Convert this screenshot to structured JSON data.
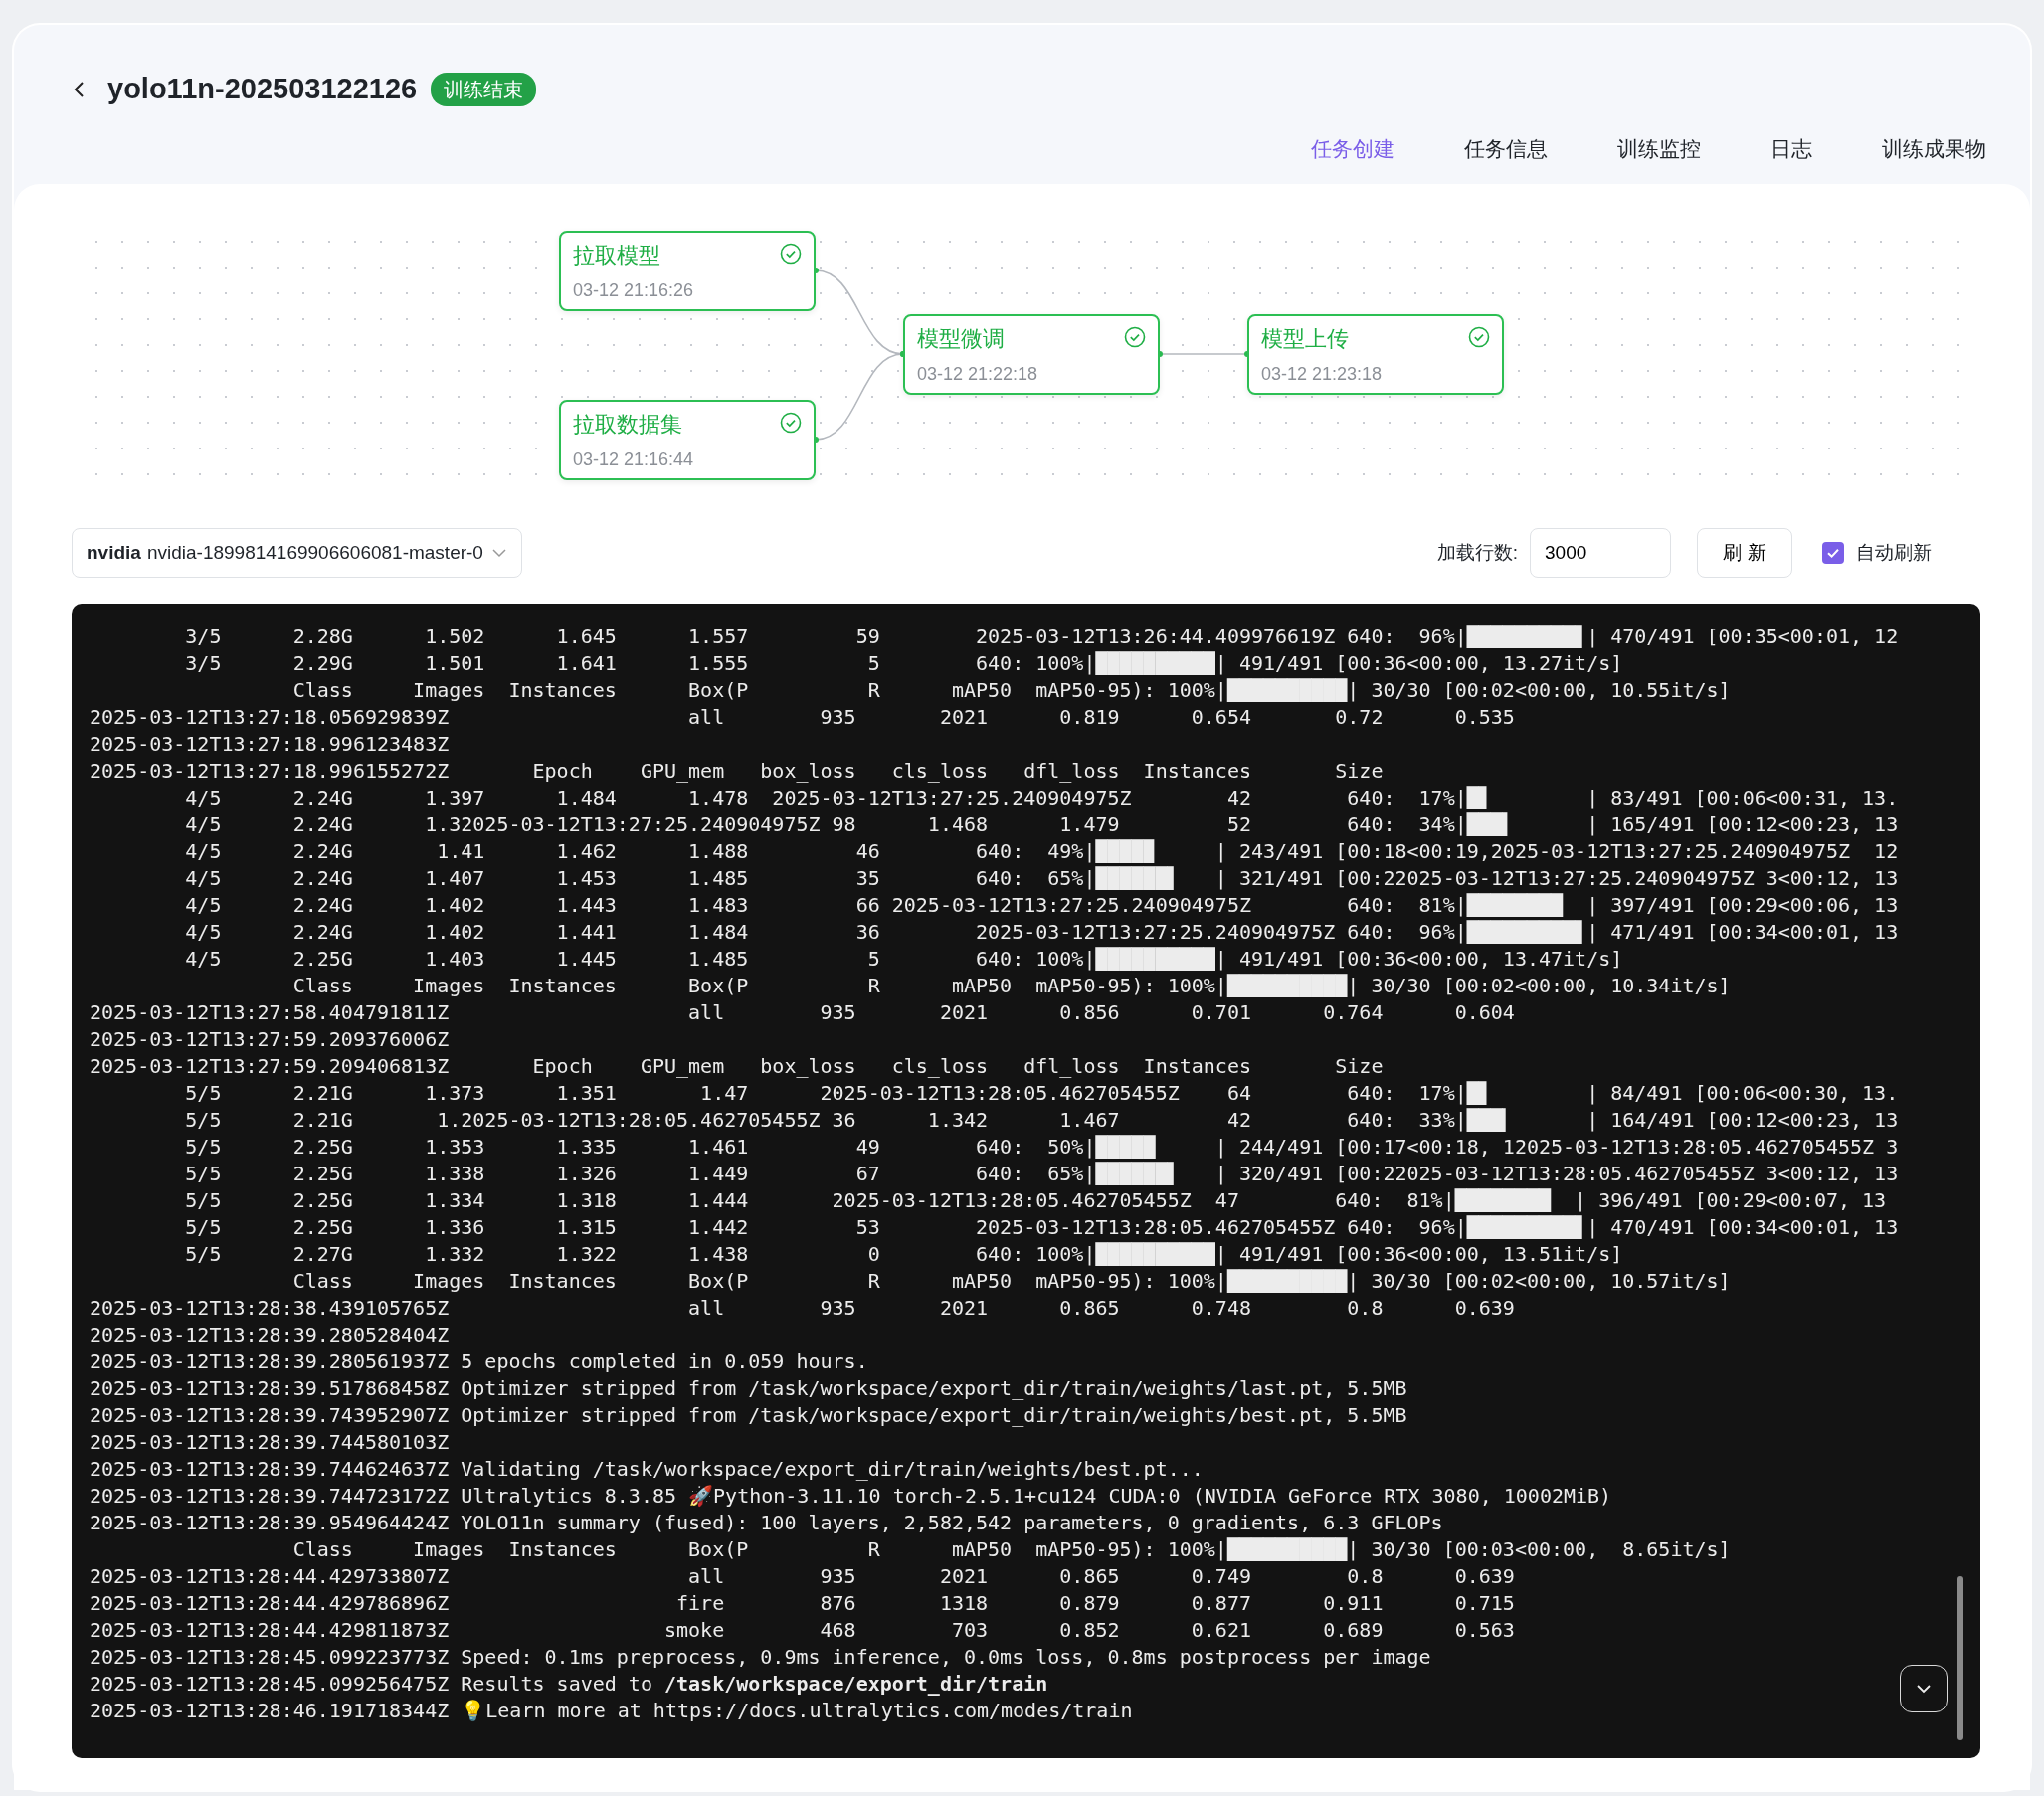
{
  "header": {
    "title": "yolo11n-202503122126",
    "status": "训练结束"
  },
  "tabs": [
    {
      "label": "任务创建",
      "selected": true
    },
    {
      "label": "任务信息",
      "selected": false
    },
    {
      "label": "训练监控",
      "selected": false
    },
    {
      "label": "日志",
      "selected": false
    },
    {
      "label": "训练成果物",
      "selected": false
    }
  ],
  "pipeline": {
    "nodes": [
      {
        "title": "拉取模型",
        "time": "03-12 21:16:26",
        "done": true
      },
      {
        "title": "拉取数据集",
        "time": "03-12 21:16:44",
        "done": true
      },
      {
        "title": "模型微调",
        "time": "03-12 21:22:18",
        "done": true
      },
      {
        "title": "模型上传",
        "time": "03-12 21:23:18",
        "done": true
      }
    ]
  },
  "log_controls": {
    "source_prefix": "nvidia",
    "source": "nvidia-1899814169906606081-master-0",
    "lines_label": "加载行数:",
    "lines_value": "3000",
    "refresh_label": "刷 新",
    "auto_refresh": {
      "label": "自动刷新",
      "checked": true
    }
  },
  "log": {
    "lines": [
      "        3/5      2.28G      1.502      1.645      1.557         59        2025-03-12T13:26:44.409976619Z 640:  96%|█████████▋| 470/491 [00:35<00:01, 12",
      "        3/5      2.29G      1.501      1.641      1.555          5        640: 100%|██████████| 491/491 [00:36<00:00, 13.27it/s]",
      "                 Class     Images  Instances      Box(P          R      mAP50  mAP50-95): 100%|██████████| 30/30 [00:02<00:00, 10.55it/s]",
      "2025-03-12T13:27:18.056929839Z                    all        935       2021      0.819      0.654       0.72      0.535",
      "2025-03-12T13:27:18.996123483Z",
      "2025-03-12T13:27:18.996155272Z       Epoch    GPU_mem   box_loss   cls_loss   dfl_loss  Instances       Size",
      "        4/5      2.24G      1.397      1.484      1.478  2025-03-12T13:27:25.240904975Z        42        640:  17%|█▋        | 83/491 [00:06<00:31, 13.",
      "        4/5      2.24G      1.32025-03-12T13:27:25.240904975Z 98      1.468      1.479         52        640:  34%|███▍      | 165/491 [00:12<00:23, 13",
      "        4/5      2.24G       1.41      1.462      1.488         46        640:  49%|████▉     | 243/491 [00:18<00:19,2025-03-12T13:27:25.240904975Z  12",
      "        4/5      2.24G      1.407      1.453      1.485         35        640:  65%|██████▌   | 321/491 [00:22025-03-12T13:27:25.240904975Z 3<00:12, 13",
      "        4/5      2.24G      1.402      1.443      1.483         66 2025-03-12T13:27:25.240904975Z        640:  81%|████████  | 397/491 [00:29<00:06, 13",
      "        4/5      2.24G      1.402      1.441      1.484         36        2025-03-12T13:27:25.240904975Z 640:  96%|█████████▋| 471/491 [00:34<00:01, 13",
      "        4/5      2.25G      1.403      1.445      1.485          5        640: 100%|██████████| 491/491 [00:36<00:00, 13.47it/s]",
      "                 Class     Images  Instances      Box(P          R      mAP50  mAP50-95): 100%|██████████| 30/30 [00:02<00:00, 10.34it/s]",
      "2025-03-12T13:27:58.404791811Z                    all        935       2021      0.856      0.701      0.764      0.604",
      "2025-03-12T13:27:59.209376006Z",
      "2025-03-12T13:27:59.209406813Z       Epoch    GPU_mem   box_loss   cls_loss   dfl_loss  Instances       Size",
      "        5/5      2.21G      1.373      1.351       1.47      2025-03-12T13:28:05.462705455Z    64        640:  17%|█▋        | 84/491 [00:06<00:30, 13.",
      "        5/5      2.21G       1.2025-03-12T13:28:05.462705455Z 36      1.342      1.467         42        640:  33%|███▎      | 164/491 [00:12<00:23, 13",
      "        5/5      2.25G      1.353      1.335      1.461         49        640:  50%|█████     | 244/491 [00:17<00:18, 12025-03-12T13:28:05.462705455Z 3",
      "        5/5      2.25G      1.338      1.326      1.449         67        640:  65%|██████▌   | 320/491 [00:22025-03-12T13:28:05.462705455Z 3<00:12, 13",
      "        5/5      2.25G      1.334      1.318      1.444       2025-03-12T13:28:05.462705455Z  47        640:  81%|████████  | 396/491 [00:29<00:07, 13",
      "        5/5      2.25G      1.336      1.315      1.442         53        2025-03-12T13:28:05.462705455Z 640:  96%|█████████▋| 470/491 [00:34<00:01, 13",
      "        5/5      2.27G      1.332      1.322      1.438          0        640: 100%|██████████| 491/491 [00:36<00:00, 13.51it/s]",
      "                 Class     Images  Instances      Box(P          R      mAP50  mAP50-95): 100%|██████████| 30/30 [00:02<00:00, 10.57it/s]",
      "2025-03-12T13:28:38.439105765Z                    all        935       2021      0.865      0.748        0.8      0.639",
      "2025-03-12T13:28:39.280528404Z",
      "2025-03-12T13:28:39.280561937Z 5 epochs completed in 0.059 hours.",
      "2025-03-12T13:28:39.517868458Z Optimizer stripped from /task/workspace/export_dir/train/weights/last.pt, 5.5MB",
      "2025-03-12T13:28:39.743952907Z Optimizer stripped from /task/workspace/export_dir/train/weights/best.pt, 5.5MB",
      "2025-03-12T13:28:39.744580103Z",
      "2025-03-12T13:28:39.744624637Z Validating /task/workspace/export_dir/train/weights/best.pt...",
      "2025-03-12T13:28:39.744723172Z Ultralytics 8.3.85 🚀Python-3.11.10 torch-2.5.1+cu124 CUDA:0 (NVIDIA GeForce RTX 3080, 10002MiB)",
      "2025-03-12T13:28:39.954964424Z YOLO11n summary (fused): 100 layers, 2,582,542 parameters, 0 gradients, 6.3 GFLOPs",
      "                 Class     Images  Instances      Box(P          R      mAP50  mAP50-95): 100%|██████████| 30/30 [00:03<00:00,  8.65it/s]",
      "2025-03-12T13:28:44.429733807Z                    all        935       2021      0.865      0.749        0.8      0.639",
      "2025-03-12T13:28:44.429786896Z                   fire        876       1318      0.879      0.877      0.911      0.715",
      "2025-03-12T13:28:44.429811873Z                  smoke        468        703      0.852      0.621      0.689      0.563",
      "2025-03-12T13:28:45.099223773Z Speed: 0.1ms preprocess, 0.9ms inference, 0.0ms loss, 0.8ms postprocess per image",
      "2025-03-12T13:28:45.099256475Z Results saved to **/task/workspace/export_dir/train**",
      "2025-03-12T13:28:46.191718344Z 💡Learn more at https://docs.ultralytics.com/modes/train"
    ]
  }
}
